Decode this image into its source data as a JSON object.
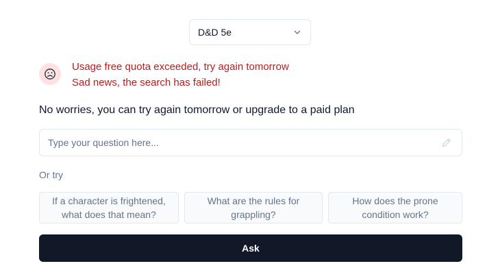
{
  "system_select": {
    "value": "D&D 5e",
    "icon": "chevron-down-icon"
  },
  "error": {
    "icon": "frown-face-icon",
    "line1": "Usage free quota exceeded, try again tomorrow",
    "line2": "Sad news, the search has failed!",
    "color": "#b91c1c",
    "icon_bg": "#fee2e2"
  },
  "info_text": "No worries, you can try again tomorrow or upgrade to a paid plan",
  "question": {
    "placeholder": "Type your question here...",
    "value": "",
    "icon": "pencil-icon"
  },
  "or_try_label": "Or try",
  "suggestions": [
    "If a character is frightened, what does that mean?",
    "What are the rules for grappling?",
    "How does the prone condition work?"
  ],
  "ask_button": {
    "label": "Ask",
    "color": "#111827"
  }
}
